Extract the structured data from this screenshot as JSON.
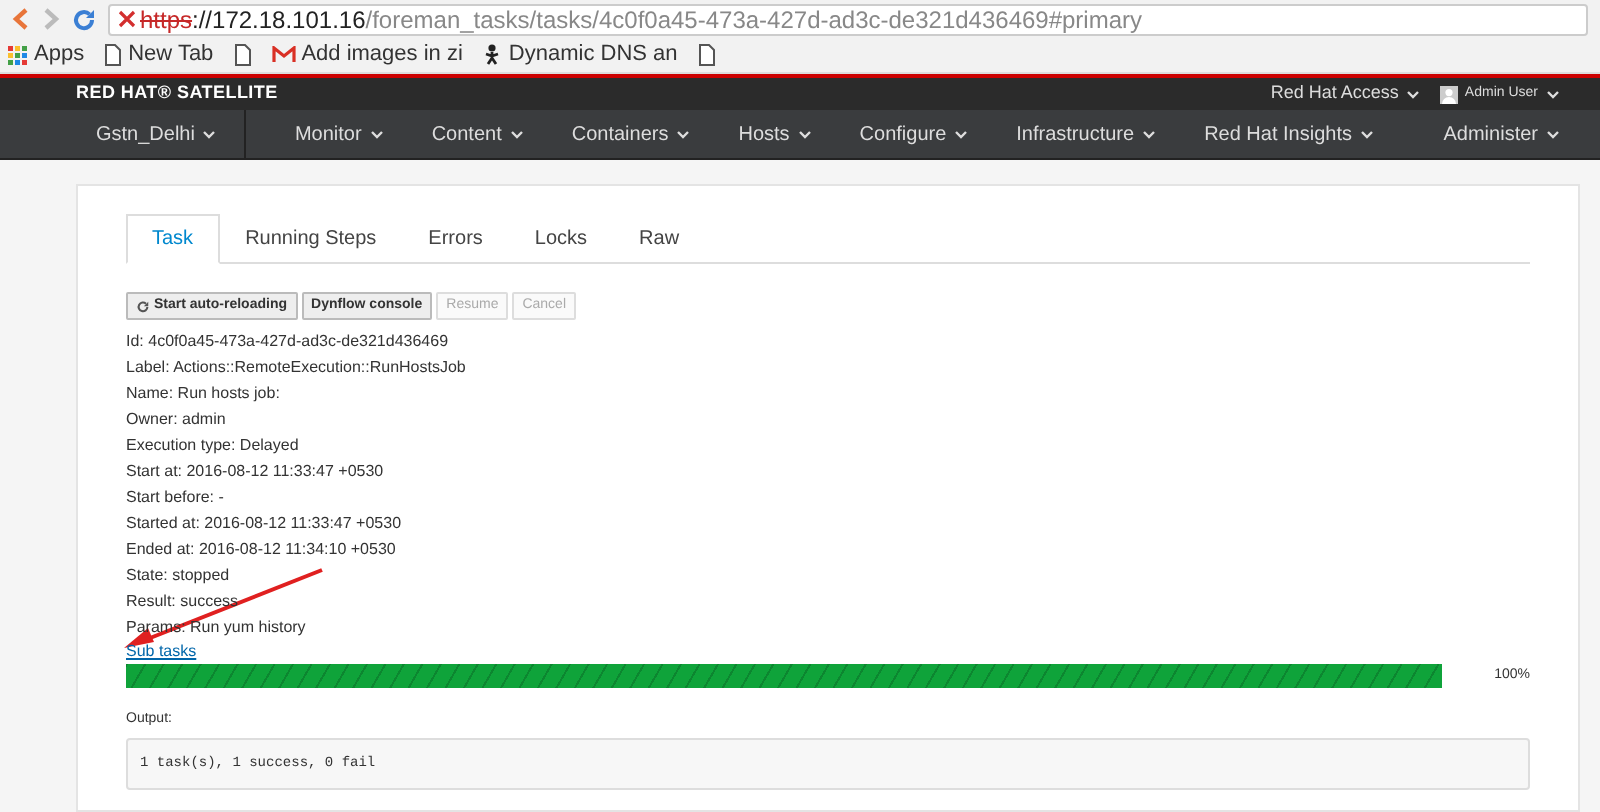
{
  "browser": {
    "url": {
      "scheme": "https",
      "host": "://172.18.101.16",
      "path": "/foreman_tasks/tasks/4c0f0a45-473a-427d-ad3c-de321d436469#primary"
    },
    "bookmarks": [
      {
        "kind": "apps",
        "label": "Apps"
      },
      {
        "kind": "page",
        "label": "New Tab"
      },
      {
        "kind": "page"
      },
      {
        "kind": "gmail",
        "label": "Add images in zi"
      },
      {
        "kind": "dns",
        "label": "Dynamic DNS an"
      },
      {
        "kind": "page"
      }
    ]
  },
  "header": {
    "brand": "RED HAT® SATELLITE",
    "access": "Red Hat Access",
    "user": "Admin User"
  },
  "nav": {
    "left": [
      {
        "label": "Gstn_Delhi"
      },
      {
        "label": "Monitor"
      },
      {
        "label": "Content"
      },
      {
        "label": "Containers"
      },
      {
        "label": "Hosts"
      },
      {
        "label": "Configure"
      },
      {
        "label": "Infrastructure"
      },
      {
        "label": "Red Hat Insights"
      }
    ],
    "right": "Administer"
  },
  "tabs": [
    {
      "label": "Task",
      "selected": true
    },
    {
      "label": "Running Steps",
      "selected": false
    },
    {
      "label": "Errors",
      "selected": false
    },
    {
      "label": "Locks",
      "selected": false
    },
    {
      "label": "Raw",
      "selected": false
    }
  ],
  "buttons": [
    {
      "label": "Start auto-reloading",
      "icon": true,
      "disabled": false
    },
    {
      "label": "Dynflow console",
      "icon": false,
      "disabled": false
    },
    {
      "label": "Resume",
      "icon": false,
      "disabled": true
    },
    {
      "label": "Cancel",
      "icon": false,
      "disabled": true
    }
  ],
  "details": [
    "Id: 4c0f0a45-473a-427d-ad3c-de321d436469",
    "Label: Actions::RemoteExecution::RunHostsJob",
    "Name: Run hosts job:",
    "Owner: admin",
    "Execution type: Delayed",
    "Start at: 2016-08-12 11:33:47 +0530",
    "Start before: -",
    "Started at: 2016-08-12 11:33:47 +0530",
    "Ended at: 2016-08-12 11:34:10 +0530",
    "State: stopped",
    "Result: success",
    "Params: Run yum history"
  ],
  "sub_tasks_link": "Sub tasks",
  "progress": {
    "level": 1,
    "reading": "100%"
  },
  "output": {
    "label": "Output:",
    "text": "1 task(s), 1 success, 0 fail"
  }
}
